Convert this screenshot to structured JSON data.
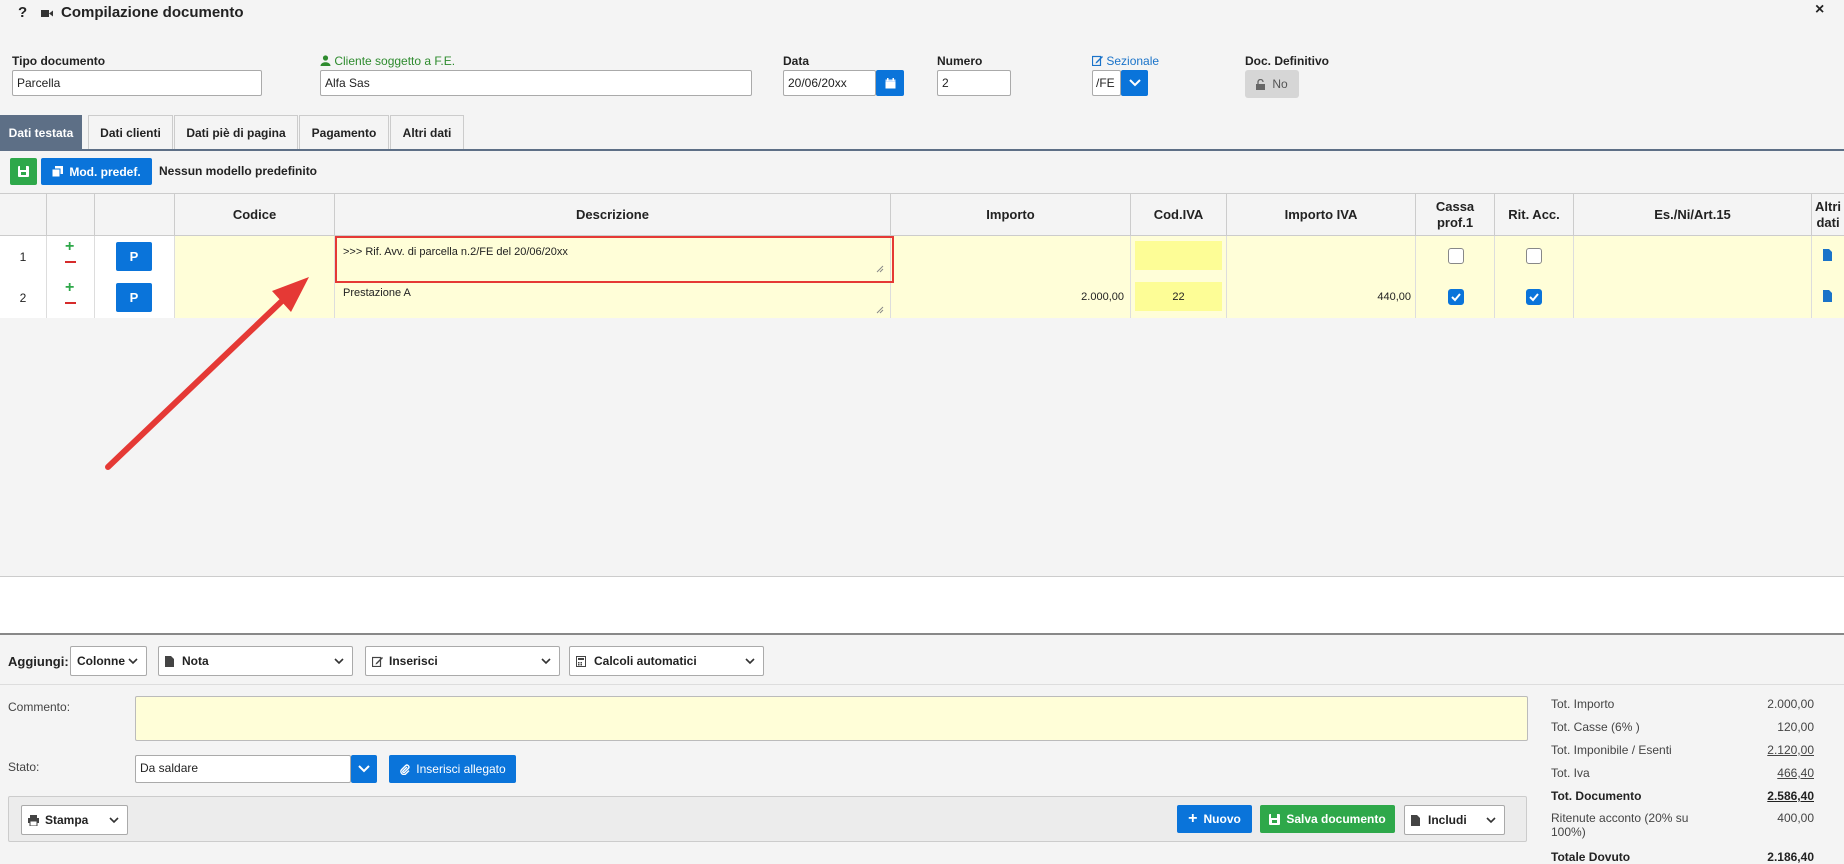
{
  "window": {
    "help": "?",
    "title": "Compilazione documento",
    "close": "×"
  },
  "header": {
    "tipo_documento": {
      "label": "Tipo documento",
      "value": "Parcella"
    },
    "cliente": {
      "label": "Cliente soggetto a F.E.",
      "value": "Alfa Sas"
    },
    "data": {
      "label": "Data",
      "value": "20/06/20xx"
    },
    "numero": {
      "label": "Numero",
      "value": "2"
    },
    "sezionale": {
      "label": "Sezionale",
      "value": "/FE"
    },
    "doc_definitivo": {
      "label": "Doc. Definitivo",
      "value": "No"
    }
  },
  "tabs": [
    {
      "label": "Dati testata",
      "active": true
    },
    {
      "label": "Dati clienti",
      "active": false
    },
    {
      "label": "Dati piè di pagina",
      "active": false
    },
    {
      "label": "Pagamento",
      "active": false
    },
    {
      "label": "Altri dati",
      "active": false
    }
  ],
  "toolbar": {
    "mod_predef_label": "Mod. predef.",
    "modello_text": "Nessun modello predefinito"
  },
  "table": {
    "columns": [
      "Codice",
      "Descrizione",
      "Importo",
      "Cod.IVA",
      "Importo IVA",
      "Cassa prof.1",
      "Rit. Acc.",
      "Es./Ni/Art.15",
      "Altri dati"
    ],
    "rows": [
      {
        "num": "1",
        "p": "P",
        "codice": "",
        "descrizione": ">>> Rif. Avv. di parcella n.2/FE del 20/06/20xx",
        "importo": "",
        "cod_iva": "",
        "importo_iva": "",
        "cassa": false,
        "rit": false,
        "es": ""
      },
      {
        "num": "2",
        "p": "P",
        "codice": "",
        "descrizione": "Prestazione A",
        "importo": "2.000,00",
        "cod_iva": "22",
        "importo_iva": "440,00",
        "cassa": true,
        "rit": true,
        "es": ""
      }
    ]
  },
  "aggiungi": {
    "label": "Aggiungi:",
    "colonne": "Colonne",
    "nota": "Nota",
    "inserisci": "Inserisci",
    "calcoli": "Calcoli automatici"
  },
  "commento": {
    "label": "Commento:",
    "value": ""
  },
  "stato": {
    "label": "Stato:",
    "value": "Da saldare",
    "allegato": "Inserisci allegato"
  },
  "actions": {
    "stampa": "Stampa",
    "nuovo": "Nuovo",
    "salva": "Salva documento",
    "includi": "Includi"
  },
  "totals": [
    {
      "label": "Tot. Importo",
      "value": "2.000,00",
      "bold": false,
      "underline": false
    },
    {
      "label": "Tot. Casse (6% )",
      "value": "120,00",
      "bold": false,
      "underline": false
    },
    {
      "label": "Tot. Imponibile / Esenti",
      "value": "2.120,00",
      "bold": false,
      "underline": true
    },
    {
      "label": "Tot. Iva",
      "value": "466,40",
      "bold": false,
      "underline": true
    },
    {
      "label": "Tot. Documento",
      "value": "2.586,40",
      "bold": true,
      "underline": true
    },
    {
      "label": "Ritenute acconto (20% su 100%)",
      "value": "400,00",
      "bold": false,
      "underline": false
    },
    {
      "label": "Totale Dovuto",
      "value": "2.186,40",
      "bold": true,
      "underline": false
    }
  ],
  "colors": {
    "primary": "#0a74da",
    "success": "#2ea84a",
    "tab_active": "#5d6f86",
    "highlight": "#e53935",
    "yellow_cell": "#fffed8"
  }
}
